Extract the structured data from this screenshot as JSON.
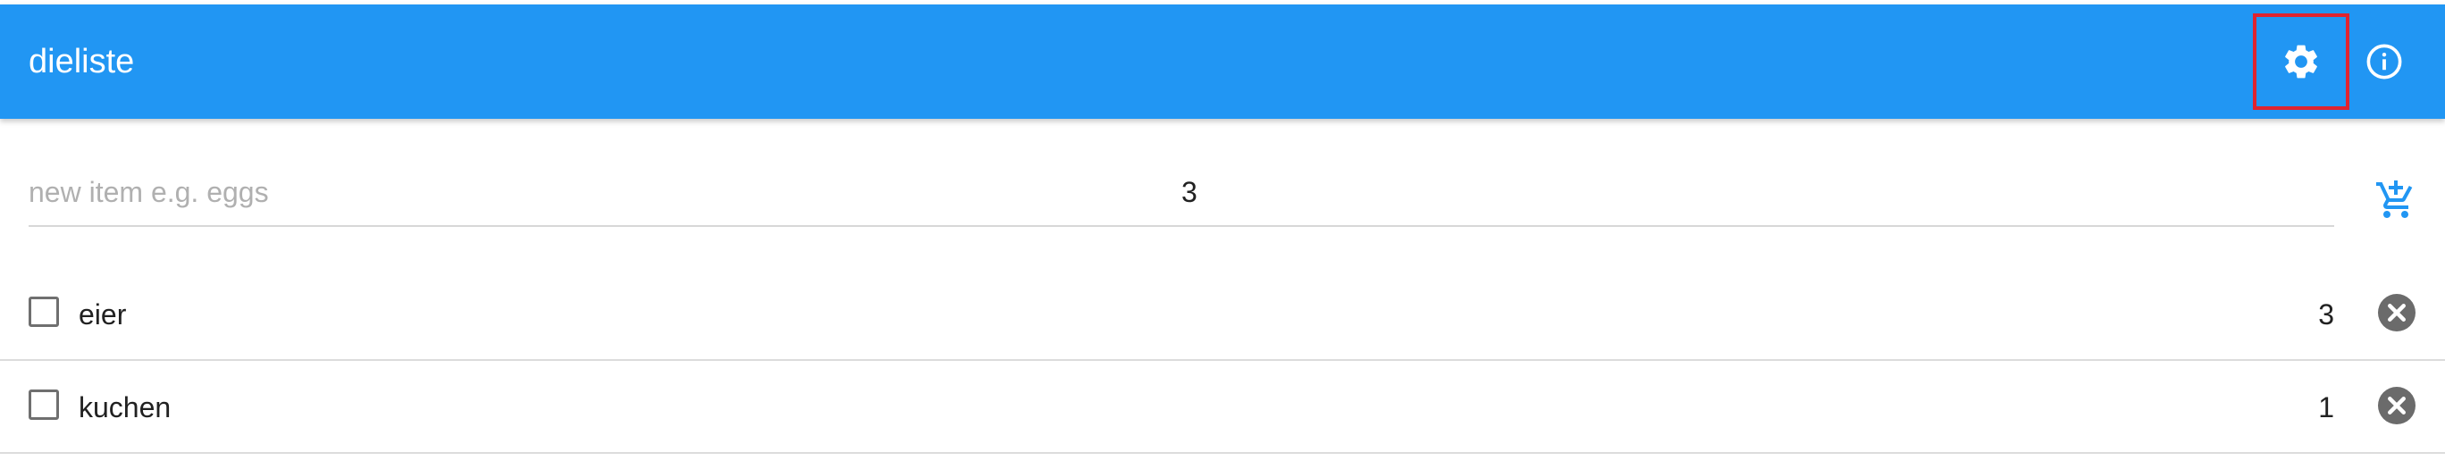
{
  "app": {
    "title": "dieliste",
    "bar_color": "#2196f3",
    "settings_icon": "gear-icon",
    "info_icon": "info-icon"
  },
  "new_item": {
    "name_placeholder": "new item e.g. eggs",
    "name_value": "",
    "quantity_value": "3",
    "add_icon": "add-to-cart-icon"
  },
  "items": [
    {
      "name": "eier",
      "quantity": "3",
      "checked": false
    },
    {
      "name": "kuchen",
      "quantity": "1",
      "checked": false
    }
  ]
}
